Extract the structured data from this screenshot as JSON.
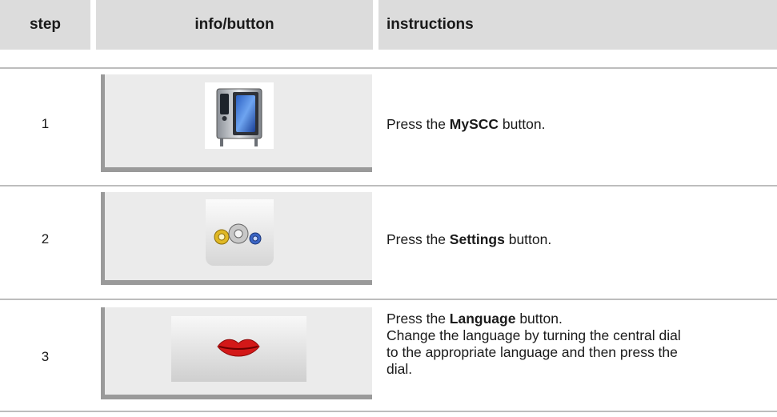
{
  "header": {
    "step": "step",
    "info": "info/button",
    "instructions": "instructions"
  },
  "rows": [
    {
      "step": "1",
      "icon": "oven-icon",
      "instruction": {
        "pre": "Press the ",
        "bold": "MySCC",
        "post": " button."
      }
    },
    {
      "step": "2",
      "icon": "gears-icon",
      "instruction": {
        "pre": "Press the ",
        "bold": "Settings",
        "post": " button."
      }
    },
    {
      "step": "3",
      "icon": "lips-icon",
      "instruction": {
        "pre": "Press the ",
        "bold": "Language",
        "post": " button.",
        "line2": "Change the language by turning the central dial",
        "line3": "to the appropriate language and then press the",
        "line4": "dial."
      }
    }
  ]
}
